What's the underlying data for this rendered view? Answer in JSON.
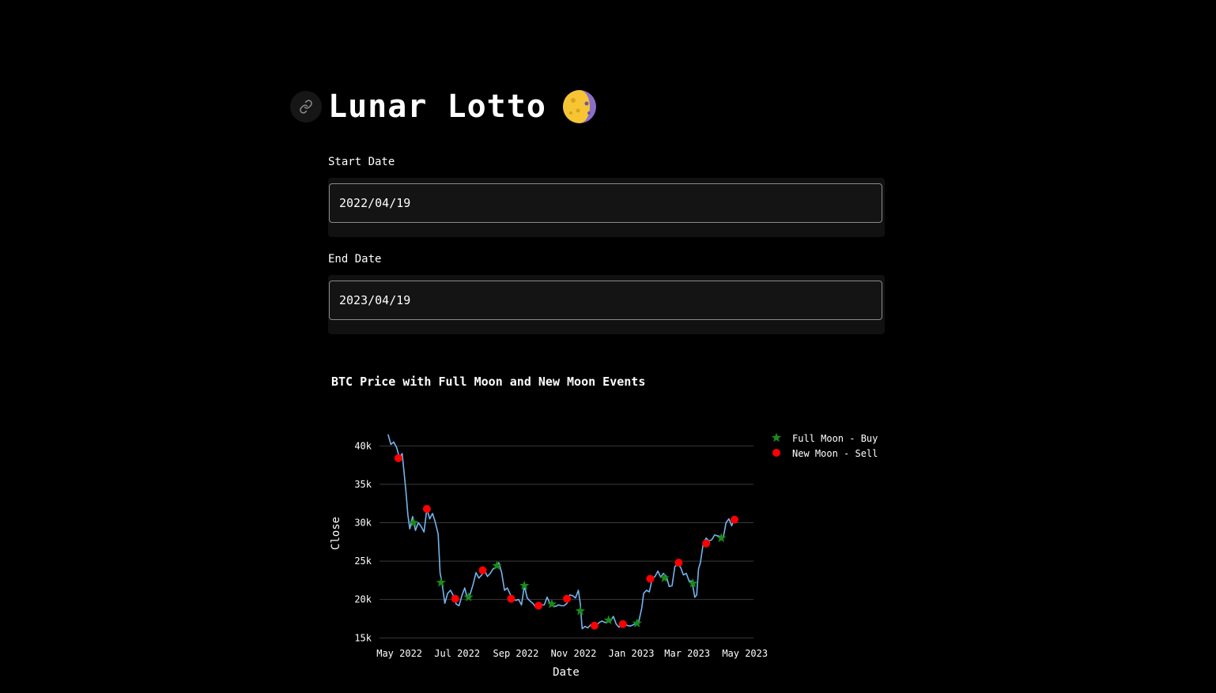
{
  "header": {
    "title": "Lunar Lotto",
    "title_icon": "waxing-crescent-moon-icon",
    "anchor_icon": "link-icon"
  },
  "form": {
    "start_label": "Start Date",
    "start_value": "2022/04/19",
    "end_label": "End Date",
    "end_value": "2023/04/19"
  },
  "colors": {
    "price_line": "#74b4ee",
    "full_moon": "#1a8a1a",
    "new_moon": "#ff0000",
    "grid": "#3a3a3a"
  },
  "chart_data": {
    "type": "line",
    "title": "BTC Price with Full Moon and New Moon Events",
    "xlabel": "Date",
    "ylabel": "Close",
    "xlim": [
      "2022-04-10",
      "2023-05-10"
    ],
    "ylim": [
      14000,
      42500
    ],
    "yticks": [
      15000,
      20000,
      25000,
      30000,
      35000,
      40000
    ],
    "ytick_labels": [
      "15k",
      "20k",
      "25k",
      "30k",
      "35k",
      "40k"
    ],
    "xticks": [
      "2022-05-01",
      "2022-07-01",
      "2022-09-01",
      "2022-11-01",
      "2023-01-01",
      "2023-03-01",
      "2023-05-01"
    ],
    "xtick_labels": [
      "May 2022",
      "Jul 2022",
      "Sep 2022",
      "Nov 2022",
      "Jan 2023",
      "Mar 2023",
      "May 2023"
    ],
    "grid": "horizontal",
    "legend_position": "top-right",
    "series": [
      {
        "name": "Close",
        "style": "line",
        "x": [
          "2022-04-19",
          "2022-04-22",
          "2022-04-25",
          "2022-04-28",
          "2022-05-01",
          "2022-05-04",
          "2022-05-06",
          "2022-05-08",
          "2022-05-10",
          "2022-05-12",
          "2022-05-15",
          "2022-05-18",
          "2022-05-21",
          "2022-05-24",
          "2022-05-27",
          "2022-05-30",
          "2022-06-02",
          "2022-06-05",
          "2022-06-08",
          "2022-06-11",
          "2022-06-13",
          "2022-06-15",
          "2022-06-18",
          "2022-06-21",
          "2022-06-24",
          "2022-06-27",
          "2022-06-30",
          "2022-07-03",
          "2022-07-06",
          "2022-07-09",
          "2022-07-12",
          "2022-07-15",
          "2022-07-18",
          "2022-07-21",
          "2022-07-24",
          "2022-07-27",
          "2022-07-30",
          "2022-08-02",
          "2022-08-05",
          "2022-08-08",
          "2022-08-11",
          "2022-08-14",
          "2022-08-17",
          "2022-08-20",
          "2022-08-23",
          "2022-08-26",
          "2022-08-29",
          "2022-09-01",
          "2022-09-04",
          "2022-09-07",
          "2022-09-10",
          "2022-09-13",
          "2022-09-16",
          "2022-09-19",
          "2022-09-22",
          "2022-09-25",
          "2022-09-28",
          "2022-10-01",
          "2022-10-04",
          "2022-10-07",
          "2022-10-10",
          "2022-10-13",
          "2022-10-16",
          "2022-10-19",
          "2022-10-22",
          "2022-10-25",
          "2022-10-28",
          "2022-10-31",
          "2022-11-03",
          "2022-11-06",
          "2022-11-08",
          "2022-11-10",
          "2022-11-13",
          "2022-11-16",
          "2022-11-19",
          "2022-11-22",
          "2022-11-25",
          "2022-11-28",
          "2022-12-01",
          "2022-12-04",
          "2022-12-07",
          "2022-12-10",
          "2022-12-13",
          "2022-12-16",
          "2022-12-19",
          "2022-12-22",
          "2022-12-25",
          "2022-12-28",
          "2022-12-31",
          "2023-01-03",
          "2023-01-06",
          "2023-01-09",
          "2023-01-12",
          "2023-01-14",
          "2023-01-17",
          "2023-01-20",
          "2023-01-23",
          "2023-01-26",
          "2023-01-29",
          "2023-02-01",
          "2023-02-04",
          "2023-02-07",
          "2023-02-10",
          "2023-02-13",
          "2023-02-16",
          "2023-02-19",
          "2023-02-22",
          "2023-02-25",
          "2023-02-28",
          "2023-03-03",
          "2023-03-06",
          "2023-03-09",
          "2023-03-11",
          "2023-03-13",
          "2023-03-15",
          "2023-03-18",
          "2023-03-21",
          "2023-03-24",
          "2023-03-27",
          "2023-03-30",
          "2023-04-02",
          "2023-04-05",
          "2023-04-08",
          "2023-04-11",
          "2023-04-14",
          "2023-04-17",
          "2023-04-19"
        ],
        "values": [
          41500,
          40200,
          40500,
          39800,
          38500,
          39000,
          36500,
          34000,
          31000,
          29200,
          30800,
          29000,
          30000,
          29500,
          28800,
          31800,
          30500,
          31200,
          30000,
          28500,
          23500,
          22200,
          19500,
          20800,
          21200,
          20500,
          19400,
          19200,
          20500,
          21500,
          20000,
          20800,
          22000,
          23500,
          22800,
          23200,
          23800,
          23000,
          23400,
          24000,
          24200,
          24800,
          23500,
          21200,
          21500,
          20700,
          20000,
          19900,
          20000,
          19300,
          21800,
          20200,
          19800,
          19500,
          19000,
          19100,
          19300,
          19300,
          20300,
          19500,
          19200,
          19100,
          19300,
          19200,
          19200,
          19500,
          20600,
          20500,
          20200,
          21200,
          19500,
          16200,
          16500,
          16300,
          16700,
          16400,
          16600,
          17000,
          17200,
          17000,
          17100,
          17200,
          17800,
          16800,
          16400,
          16800,
          16850,
          16600,
          16550,
          16700,
          16950,
          17200,
          18900,
          20800,
          21200,
          21000,
          22700,
          23000,
          23700,
          22900,
          23400,
          23000,
          21700,
          21800,
          24300,
          24600,
          24200,
          23200,
          23400,
          22400,
          22400,
          20300,
          20600,
          24000,
          24800,
          27300,
          28000,
          27600,
          27800,
          28400,
          28300,
          28200,
          28000,
          30000,
          30500,
          29600,
          30300
        ]
      },
      {
        "name": "Full Moon - Buy",
        "style": "marker-star",
        "x": [
          "2022-05-16",
          "2022-06-14",
          "2022-07-13",
          "2022-08-12",
          "2022-09-10",
          "2022-10-09",
          "2022-11-08",
          "2022-12-08",
          "2023-01-07",
          "2023-02-05",
          "2023-03-07",
          "2023-04-06"
        ],
        "values": [
          30000,
          22200,
          20300,
          24400,
          21800,
          19400,
          18500,
          17300,
          16900,
          22800,
          22100,
          28000
        ]
      },
      {
        "name": "New Moon - Sell",
        "style": "marker-circle",
        "x": [
          "2022-04-30",
          "2022-05-30",
          "2022-06-29",
          "2022-07-28",
          "2022-08-27",
          "2022-09-25",
          "2022-10-25",
          "2022-11-23",
          "2022-12-23",
          "2023-01-21",
          "2023-02-20",
          "2023-03-21",
          "2023-04-20"
        ],
        "values": [
          38400,
          31800,
          20100,
          23800,
          20100,
          19200,
          20100,
          16600,
          16800,
          22700,
          24800,
          27300,
          30400
        ]
      }
    ]
  }
}
